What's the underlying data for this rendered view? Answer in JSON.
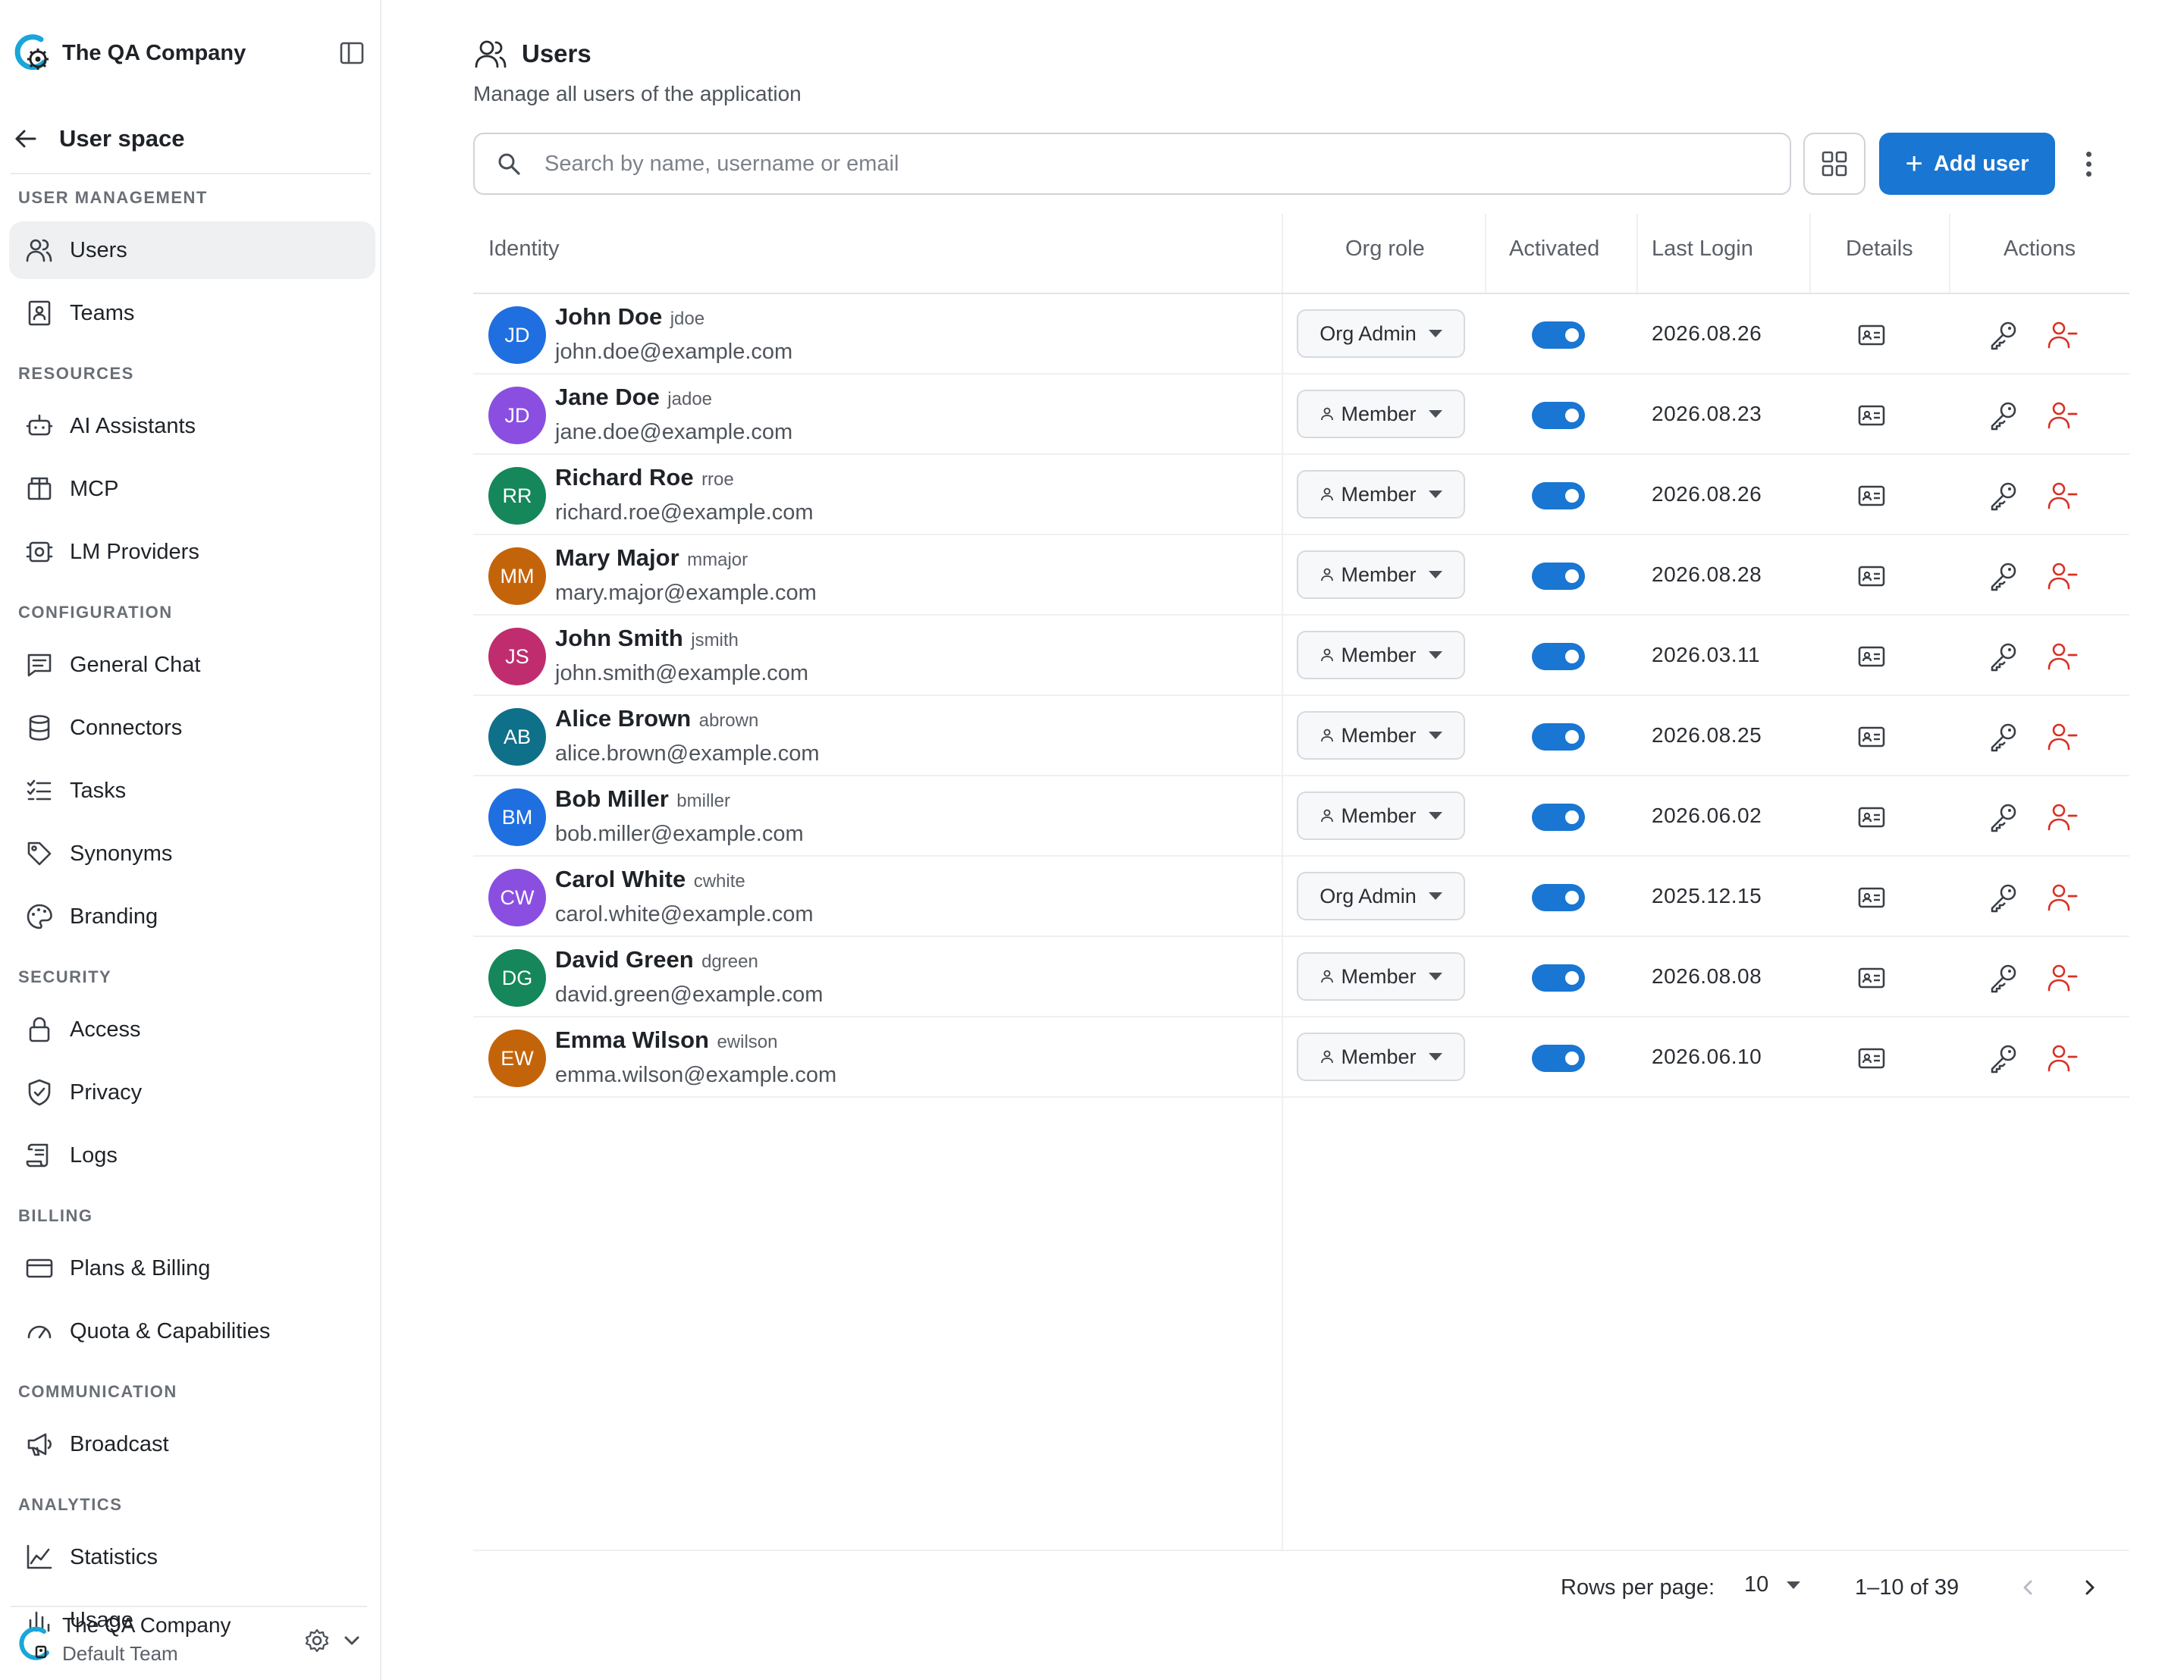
{
  "sidebar": {
    "brand_name": "The QA Company",
    "back_label": "User space",
    "sections": [
      {
        "title": "USER MANAGEMENT",
        "items": [
          {
            "label": "Users",
            "icon": "users-icon",
            "active": true
          },
          {
            "label": "Teams",
            "icon": "team-badge-icon"
          }
        ]
      },
      {
        "title": "RESOURCES",
        "items": [
          {
            "label": "AI Assistants",
            "icon": "robot-icon"
          },
          {
            "label": "MCP",
            "icon": "package-icon"
          },
          {
            "label": "LM Providers",
            "icon": "chip-icon"
          }
        ]
      },
      {
        "title": "CONFIGURATION",
        "items": [
          {
            "label": "General Chat",
            "icon": "chat-icon"
          },
          {
            "label": "Connectors",
            "icon": "database-icon"
          },
          {
            "label": "Tasks",
            "icon": "checklist-icon"
          },
          {
            "label": "Synonyms",
            "icon": "tag-icon"
          },
          {
            "label": "Branding",
            "icon": "palette-icon"
          }
        ]
      },
      {
        "title": "SECURITY",
        "items": [
          {
            "label": "Access",
            "icon": "lock-icon"
          },
          {
            "label": "Privacy",
            "icon": "shield-icon"
          },
          {
            "label": "Logs",
            "icon": "scroll-icon"
          }
        ]
      },
      {
        "title": "BILLING",
        "items": [
          {
            "label": "Plans & Billing",
            "icon": "credit-card-icon"
          },
          {
            "label": "Quota & Capabilities",
            "icon": "gauge-icon"
          }
        ]
      },
      {
        "title": "COMMUNICATION",
        "items": [
          {
            "label": "Broadcast",
            "icon": "megaphone-icon"
          }
        ]
      },
      {
        "title": "ANALYTICS",
        "items": [
          {
            "label": "Statistics",
            "icon": "area-chart-icon"
          },
          {
            "label": "Usage",
            "icon": "bar-chart-icon"
          }
        ]
      }
    ],
    "footer": {
      "org_name": "The QA Company",
      "team_name": "Default Team"
    }
  },
  "header": {
    "title": "Users",
    "subtitle": "Manage all users of the application",
    "search_placeholder": "Search by name, username or email",
    "add_user_label": "Add user"
  },
  "table": {
    "columns": [
      "Identity",
      "Org role",
      "Activated",
      "Last Login",
      "Details",
      "Actions"
    ],
    "rows": [
      {
        "initials": "JD",
        "name": "John Doe",
        "username": "jdoe",
        "email": "john.doe@example.com",
        "role": "Org Admin",
        "activated": true,
        "last_login": "2026.08.26",
        "avatar_color": "#1f6fe0"
      },
      {
        "initials": "JD",
        "name": "Jane Doe",
        "username": "jadoe",
        "email": "jane.doe@example.com",
        "role": "Member",
        "activated": true,
        "last_login": "2026.08.23",
        "avatar_color": "#8a4fe0"
      },
      {
        "initials": "RR",
        "name": "Richard Roe",
        "username": "rroe",
        "email": "richard.roe@example.com",
        "role": "Member",
        "activated": true,
        "last_login": "2026.08.26",
        "avatar_color": "#15875a"
      },
      {
        "initials": "MM",
        "name": "Mary Major",
        "username": "mmajor",
        "email": "mary.major@example.com",
        "role": "Member",
        "activated": true,
        "last_login": "2026.08.28",
        "avatar_color": "#c4640a"
      },
      {
        "initials": "JS",
        "name": "John Smith",
        "username": "jsmith",
        "email": "john.smith@example.com",
        "role": "Member",
        "activated": true,
        "last_login": "2026.03.11",
        "avatar_color": "#c02d6e"
      },
      {
        "initials": "AB",
        "name": "Alice Brown",
        "username": "abrown",
        "email": "alice.brown@example.com",
        "role": "Member",
        "activated": true,
        "last_login": "2026.08.25",
        "avatar_color": "#0f7089"
      },
      {
        "initials": "BM",
        "name": "Bob Miller",
        "username": "bmiller",
        "email": "bob.miller@example.com",
        "role": "Member",
        "activated": true,
        "last_login": "2026.06.02",
        "avatar_color": "#1f6fe0"
      },
      {
        "initials": "CW",
        "name": "Carol White",
        "username": "cwhite",
        "email": "carol.white@example.com",
        "role": "Org Admin",
        "activated": true,
        "last_login": "2025.12.15",
        "avatar_color": "#8a4fe0"
      },
      {
        "initials": "DG",
        "name": "David Green",
        "username": "dgreen",
        "email": "david.green@example.com",
        "role": "Member",
        "activated": true,
        "last_login": "2026.08.08",
        "avatar_color": "#15875a"
      },
      {
        "initials": "EW",
        "name": "Emma Wilson",
        "username": "ewilson",
        "email": "emma.wilson@example.com",
        "role": "Member",
        "activated": true,
        "last_login": "2026.06.10",
        "avatar_color": "#c4640a"
      }
    ]
  },
  "pagination": {
    "rows_per_page_label": "Rows per page:",
    "rows_per_page": "10",
    "range": "1–10 of 39"
  },
  "colors": {
    "accent": "#1976d2",
    "danger": "#d93025",
    "active_bg": "#eef0f2"
  }
}
